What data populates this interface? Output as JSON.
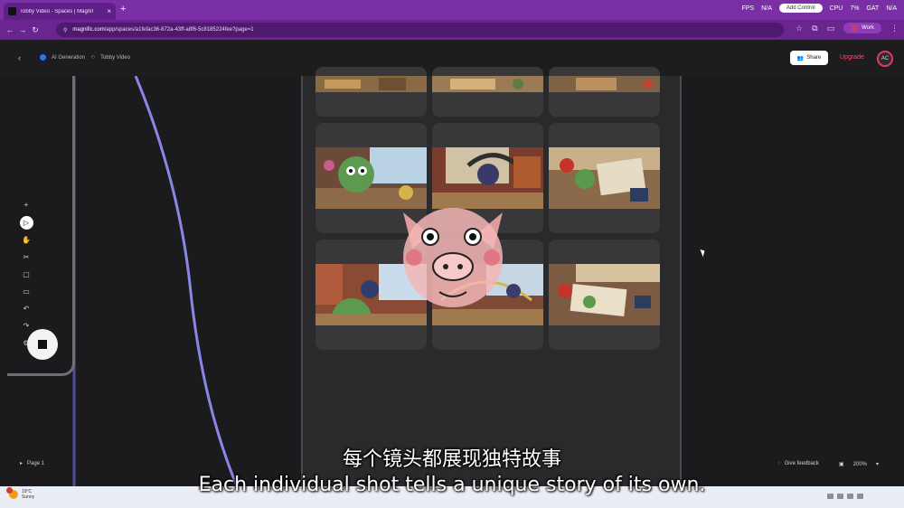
{
  "browser": {
    "tab_title": "Tobby Video - Spaces | Magnif",
    "tab_close": "×",
    "new_tab": "+",
    "url_host": "magnific.com",
    "url_path": "/app/spaces/a1fefac36-872a-43ff-a8f6-5c8185224fee?page=1",
    "stats": [
      "FPS",
      "N/A",
      "CPU",
      "7%",
      "GAT",
      "N/A"
    ],
    "overlay_pill": "Add Control",
    "profile_label": "Work"
  },
  "app": {
    "breadcrumb": [
      "AI Generation",
      "Tobby Video"
    ],
    "share_label": "Share",
    "upgrade_label": "Upgrade",
    "avatar_initials": "AC"
  },
  "toolbar": {
    "tools": [
      "add-icon",
      "play-icon",
      "hand-icon",
      "scissors-icon",
      "shape-icon",
      "comment-icon",
      "undo-icon",
      "redo-icon",
      "settings-icon"
    ],
    "glyphs": [
      "+",
      "▷",
      "✋",
      "✂",
      "▢",
      "▭",
      "↶",
      "↷",
      "⚙"
    ]
  },
  "footer": {
    "page_label": "Page 1",
    "feedback_label": "Give feedback",
    "zoom_label": "200%"
  },
  "subtitles": {
    "chinese": "每个镜头都展现独特故事",
    "english": "Each individual shot tells a unique story of its own."
  },
  "taskbar": {
    "temperature": "19°C",
    "condition": "Sunny"
  },
  "colors": {
    "browser_purple": "#7b2fa6",
    "accent_upgrade": "#ff4b6e",
    "curve_line": "#8a86e6"
  }
}
